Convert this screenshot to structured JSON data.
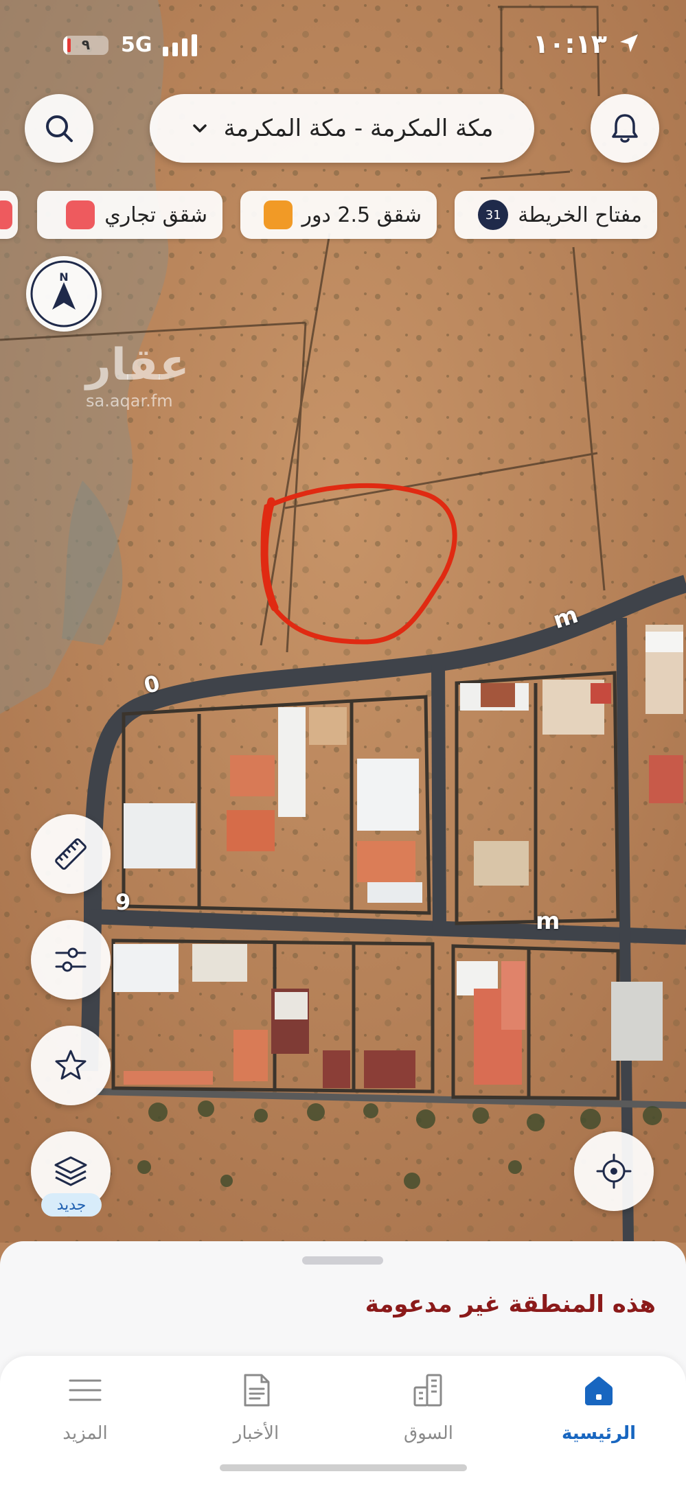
{
  "status_bar": {
    "time": "١٠:١٣",
    "network": "5G",
    "battery": "٩",
    "battery_level": 0.09
  },
  "header": {
    "search_location": "مكة المكرمة - مكة المكرمة",
    "icons": {
      "search": "search-icon",
      "bell": "bell-icon",
      "chevron": "chevron-down-icon"
    }
  },
  "legend_chips": [
    {
      "label": "مفتاح الخريطة",
      "badge": "31",
      "color": "#1f2a4a"
    },
    {
      "label": "شقق 2.5 دور",
      "color": "#f19a26"
    },
    {
      "label": "شقق تجاري",
      "color": "#ee5a5e"
    }
  ],
  "compass": {
    "letter": "N"
  },
  "watermark": {
    "brand": "عقار",
    "url": "sa.aqar.fm"
  },
  "map_labels": {
    "street_1": "m",
    "street_2": "m",
    "street_3": "0",
    "street_4": "9"
  },
  "side_controls": {
    "new_badge": "جديد",
    "icons": [
      "ruler-icon",
      "filter-sliders-icon",
      "star-icon",
      "layers-icon"
    ]
  },
  "locate_button": {
    "icon": "crosshair-icon"
  },
  "sheet": {
    "notice": "هذه المنطقة غير مدعومة"
  },
  "tabs": [
    {
      "label": "الرئيسية",
      "icon": "home-icon",
      "active": true
    },
    {
      "label": "السوق",
      "icon": "buildings-icon",
      "active": false
    },
    {
      "label": "الأخبار",
      "icon": "news-icon",
      "active": false
    },
    {
      "label": "المزيد",
      "icon": "menu-icon",
      "active": false
    }
  ],
  "colors": {
    "accent": "#1866c0",
    "notice": "#8b1a1a",
    "highlight_outline": "#e02a12"
  }
}
